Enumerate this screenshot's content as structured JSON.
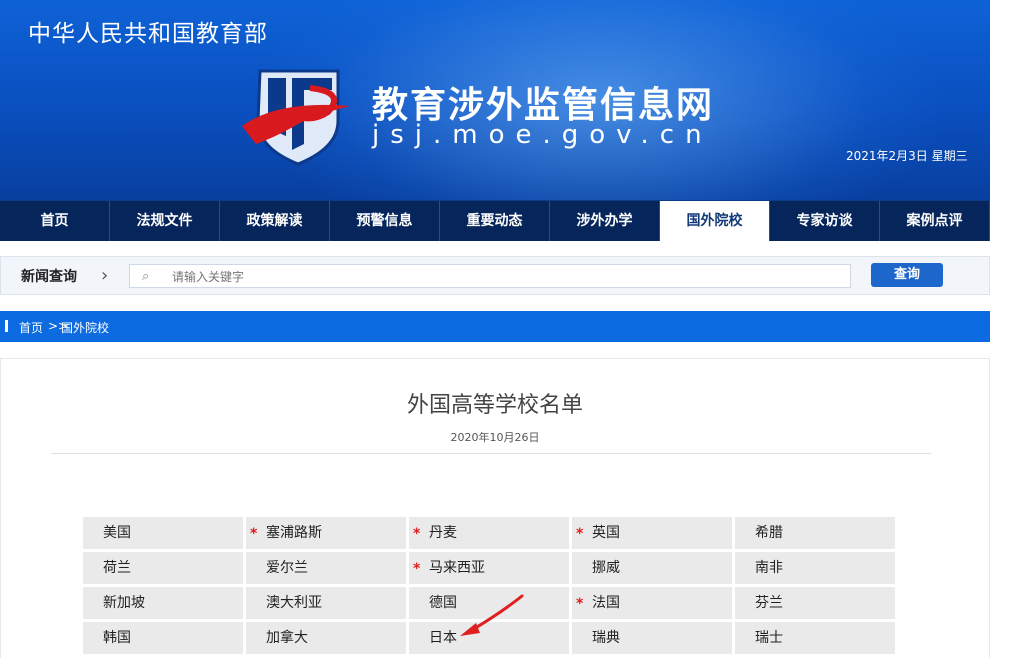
{
  "header": {
    "ministry": "中华人民共和国教育部",
    "site_title": "教育涉外监管信息网",
    "site_domain": "jsj.moe.gov.cn",
    "date": "2021年2月3日 星期三"
  },
  "nav": {
    "items": [
      "首页",
      "法规文件",
      "政策解读",
      "预警信息",
      "重要动态",
      "涉外办学",
      "国外院校",
      "专家访谈",
      "案例点评"
    ],
    "active": "国外院校"
  },
  "search": {
    "label": "新闻查询",
    "placeholder": "请输入关键字",
    "button": "查询"
  },
  "breadcrumb": {
    "home": "首页",
    "separator": ">>",
    "current": "国外院校"
  },
  "article": {
    "title": "外国高等学校名单",
    "date": "2020年10月26日"
  },
  "countries": [
    {
      "name": "美国",
      "starred": false
    },
    {
      "name": "塞浦路斯",
      "starred": true
    },
    {
      "name": "丹麦",
      "starred": true
    },
    {
      "name": "英国",
      "starred": true
    },
    {
      "name": "希腊",
      "starred": false
    },
    {
      "name": "荷兰",
      "starred": false
    },
    {
      "name": "爱尔兰",
      "starred": false
    },
    {
      "name": "马来西亚",
      "starred": true
    },
    {
      "name": "挪威",
      "starred": false
    },
    {
      "name": "南非",
      "starred": false
    },
    {
      "name": "新加坡",
      "starred": false
    },
    {
      "name": "澳大利亚",
      "starred": false
    },
    {
      "name": "德国",
      "starred": false
    },
    {
      "name": "法国",
      "starred": true
    },
    {
      "name": "芬兰",
      "starred": false
    },
    {
      "name": "韩国",
      "starred": false
    },
    {
      "name": "加拿大",
      "starred": false
    },
    {
      "name": "日本",
      "starred": false
    },
    {
      "name": "瑞典",
      "starred": false
    },
    {
      "name": "瑞士",
      "starred": false
    }
  ],
  "colors": {
    "header_blue": "#0a4fbf",
    "nav_bg": "#05255b",
    "accent": "#0c6be0",
    "star_red": "#e21a1a",
    "annotation_arrow": "#e02020"
  }
}
